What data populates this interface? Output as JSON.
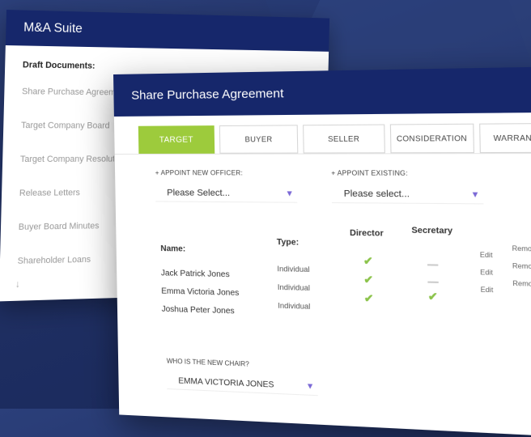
{
  "back_window": {
    "title": "M&A Suite",
    "section_label": "Draft Documents:",
    "documents": [
      "Share Purchase Agreement",
      "Target Company Board",
      "Target Company Resolution",
      "Release Letters",
      "Buyer Board Minutes",
      "Shareholder Loans"
    ]
  },
  "front_window": {
    "title": "Share Purchase Agreement",
    "tabs": [
      {
        "label": "TARGET",
        "active": true
      },
      {
        "label": "BUYER",
        "active": false
      },
      {
        "label": "SELLER",
        "active": false
      },
      {
        "label": "CONSIDERATION",
        "active": false
      },
      {
        "label": "WARRANTIES",
        "active": false
      }
    ],
    "appoint_new": {
      "label": "+ APPOINT NEW OFFICER:",
      "value": "Please Select..."
    },
    "appoint_existing": {
      "label": "+ APPOINT EXISTING:",
      "value": "Please select..."
    },
    "table": {
      "headers": {
        "name": "Name:",
        "type": "Type:",
        "director": "Director",
        "secretary": "Secretary"
      },
      "rows": [
        {
          "name": "Jack Patrick Jones",
          "type": "Individual",
          "director": true,
          "secretary": false,
          "edit": "Edit",
          "remove": "Remove"
        },
        {
          "name": "Emma Victoria Jones",
          "type": "Individual",
          "director": true,
          "secretary": false,
          "edit": "Edit",
          "remove": "Remove"
        },
        {
          "name": "Joshua Peter Jones",
          "type": "Individual",
          "director": true,
          "secretary": true,
          "edit": "Edit",
          "remove": "Remove"
        }
      ]
    },
    "chair": {
      "label": "WHO IS THE NEW CHAIR?",
      "value": "EMMA VICTORIA JONES"
    }
  },
  "colors": {
    "navy": "#16276b",
    "accent_green": "#9dcb3c",
    "chevron": "#7b69d6"
  }
}
